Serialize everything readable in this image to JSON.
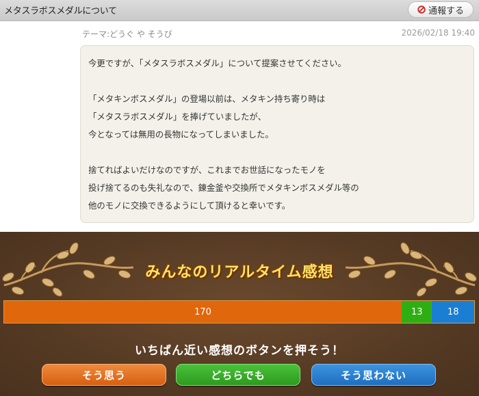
{
  "header": {
    "title": "メタスラボスメダルについて",
    "report_label": "通報する"
  },
  "post": {
    "theme": "テーマ:どうぐ や そうび",
    "date": "2026/02/18 19:40",
    "lines": [
      "今更ですが、「メタスラボスメダル」について提案させてください。",
      "",
      "「メタキンボスメダル」の登場以前は、メタキン持ち寄り時は",
      "「メタスラボスメダル」を捧げていましたが、",
      "今となっては無用の長物になってしまいました。",
      "",
      "捨てればよいだけなのですが、これまでお世話になったモノを",
      "投げ捨てるのも失礼なので、錬金釜や交換所でメタキンボスメダル等の",
      "他のモノに交換できるようにして頂けると幸いです。"
    ]
  },
  "realtime": {
    "heading": "みんなのリアルタイム感想",
    "counts": {
      "agree": 170,
      "either": 13,
      "disagree": 18
    },
    "labels": {
      "agree": "170",
      "either": "13",
      "disagree": "18"
    },
    "colors": {
      "agree": "#e0670b",
      "either": "#2fae13",
      "disagree": "#1a7fd2"
    },
    "prompt": "いちばん近い感想のボタンを押そう！",
    "buttons": {
      "agree": "そう思う",
      "either": "どちらでも",
      "disagree": "そう思わない"
    }
  }
}
